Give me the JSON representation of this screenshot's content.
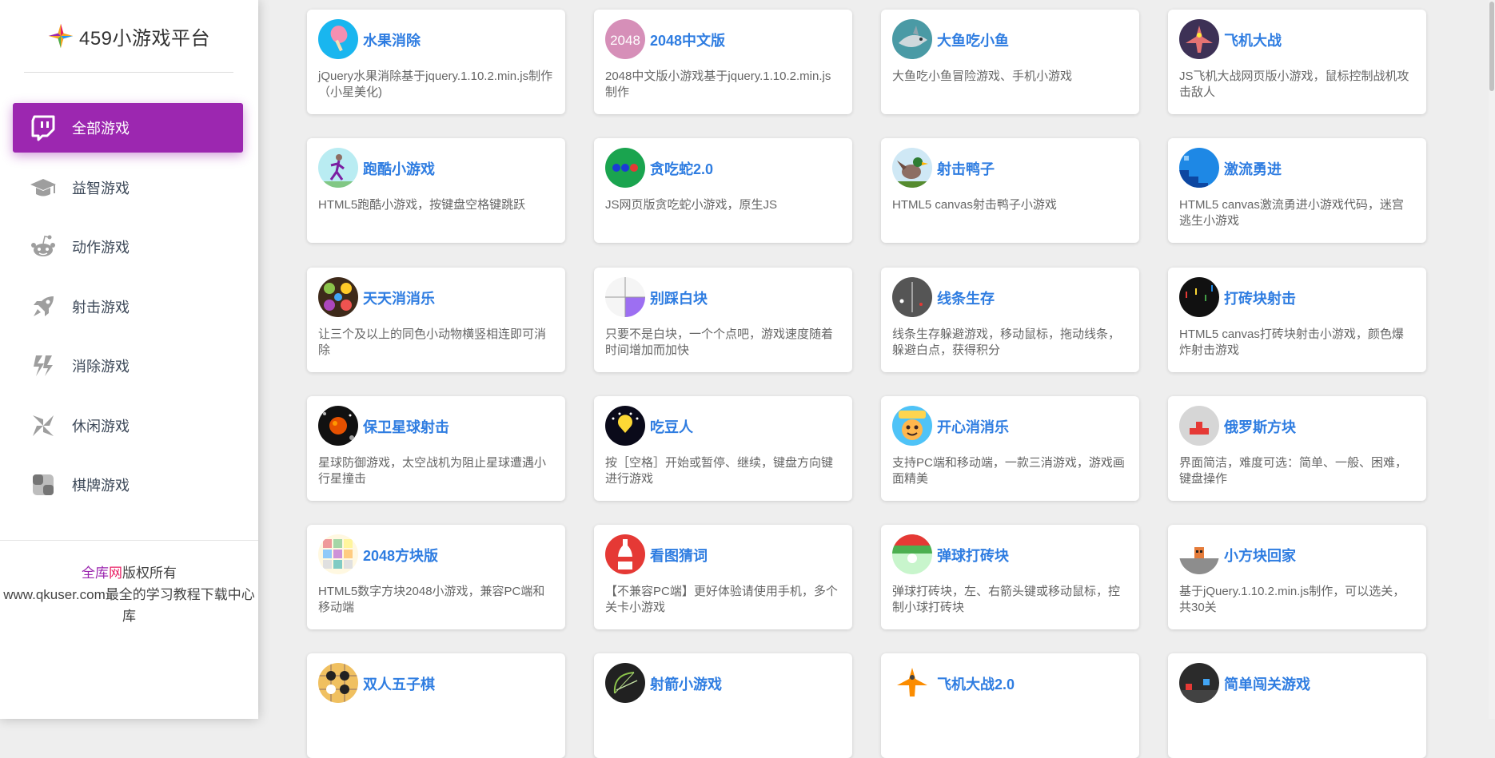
{
  "brand": {
    "title": "459小游戏平台",
    "logo_icon": "colorful-star-icon"
  },
  "nav": [
    {
      "label": "全部游戏",
      "icon": "twitch-icon",
      "active": true
    },
    {
      "label": "益智游戏",
      "icon": "graduation-cap-icon"
    },
    {
      "label": "动作游戏",
      "icon": "reddit-alien-icon"
    },
    {
      "label": "射击游戏",
      "icon": "rocket-icon"
    },
    {
      "label": "消除游戏",
      "icon": "hashnode-icon"
    },
    {
      "label": "休闲游戏",
      "icon": "pinwheel-icon"
    },
    {
      "label": "棋牌游戏",
      "icon": "checkerboard-icon"
    }
  ],
  "footer": {
    "brand_part1": "全库",
    "brand_part2": "网",
    "rights": "版权所有",
    "line2": "www.qkuser.com最全的学习教程下载中心库"
  },
  "colors": {
    "accent": "#9c27b0",
    "title_blue": "#2f7de1",
    "background": "#eeeeee"
  },
  "games": [
    {
      "title": "水果消除",
      "desc": "jQuery水果消除基于jquery.1.10.2.min.js制作（小星美化)",
      "icon": "popsicle-icon"
    },
    {
      "title": "2048中文版",
      "desc": "2048中文版小游戏基于jquery.1.10.2.min.js制作",
      "icon": "2048-icon",
      "icon_text": "2048"
    },
    {
      "title": "大鱼吃小鱼",
      "desc": "大鱼吃小鱼冒险游戏、手机小游戏",
      "icon": "shark-icon"
    },
    {
      "title": "飞机大战",
      "desc": "JS飞机大战网页版小游戏，鼠标控制战机攻击敌人",
      "icon": "plane-icon"
    },
    {
      "title": "跑酷小游戏",
      "desc": "HTML5跑酷小游戏，按键盘空格键跳跃",
      "icon": "runner-icon"
    },
    {
      "title": "贪吃蛇2.0",
      "desc": "JS网页版贪吃蛇小游戏，原生JS",
      "icon": "snake-icon"
    },
    {
      "title": "射击鸭子",
      "desc": "HTML5 canvas射击鸭子小游戏",
      "icon": "duck-icon"
    },
    {
      "title": "激流勇进",
      "desc": "HTML5 canvas激流勇进小游戏代码，迷宫逃生小游戏",
      "icon": "stairs-icon"
    },
    {
      "title": "天天消消乐",
      "desc": "让三个及以上的同色小动物横竖相连即可消除",
      "icon": "animals-icon"
    },
    {
      "title": "别踩白块",
      "desc": "只要不是白块，一个个点吧，游戏速度随着时间增加而加快",
      "icon": "tiles-icon"
    },
    {
      "title": "线条生存",
      "desc": "线条生存躲避游戏，移动鼠标，拖动线条，躲避白点，获得积分",
      "icon": "line-icon"
    },
    {
      "title": "打砖块射击",
      "desc": "HTML5 canvas打砖块射击小游戏，颜色爆炸射击游戏",
      "icon": "brick-shooter-icon"
    },
    {
      "title": "保卫星球射击",
      "desc": "星球防御游戏，太空战机为阻止星球遭遇小行星撞击",
      "icon": "planet-icon"
    },
    {
      "title": "吃豆人",
      "desc": "按［空格］开始或暂停、继续，键盘方向键进行游戏",
      "icon": "pacman-icon"
    },
    {
      "title": "开心消消乐",
      "desc": "支持PC端和移动端，一款三消游戏，游戏画面精美",
      "icon": "happy-match-icon"
    },
    {
      "title": "俄罗斯方块",
      "desc": "界面简洁，难度可选：简单、一般、困难，键盘操作",
      "icon": "tetris-icon"
    },
    {
      "title": "2048方块版",
      "desc": "HTML5数字方块2048小游戏，兼容PC端和移动端",
      "icon": "grid-icon"
    },
    {
      "title": "看图猜词",
      "desc": "【不兼容PC端】更好体验请使用手机，多个关卡小游戏",
      "icon": "bottle-icon"
    },
    {
      "title": "弹球打砖块",
      "desc": "弹球打砖块，左、右箭头键或移动鼠标，控制小球打砖块",
      "icon": "ball-icon"
    },
    {
      "title": "小方块回家",
      "desc": "基于jQuery.1.10.2.min.js制作，可以选关，共30关",
      "icon": "box-home-icon"
    },
    {
      "title": "双人五子棋",
      "desc": "",
      "icon": "gomoku-icon"
    },
    {
      "title": "射箭小游戏",
      "desc": "",
      "icon": "bow-icon"
    },
    {
      "title": "飞机大战2.0",
      "desc": "",
      "icon": "plane2-icon"
    },
    {
      "title": "简单闯关游戏",
      "desc": "",
      "icon": "level-icon"
    }
  ]
}
